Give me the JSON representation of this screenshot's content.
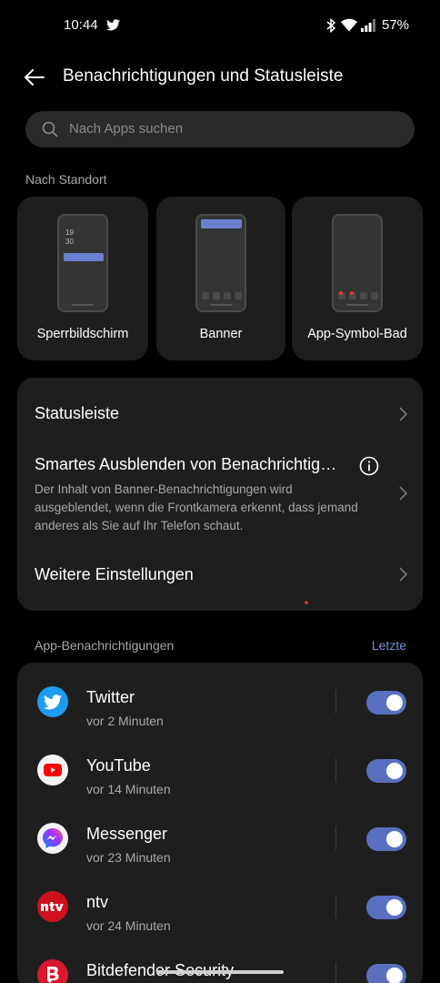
{
  "status_bar": {
    "time": "10:44",
    "battery": "57%",
    "notification_icons": [
      "twitter-icon"
    ],
    "system_icons": [
      "bluetooth-icon",
      "wifi-icon",
      "signal-icon"
    ]
  },
  "header": {
    "title": "Benachrichtigungen und Statusleiste"
  },
  "search": {
    "placeholder": "Nach Apps suchen"
  },
  "notification_styles": {
    "section_label": "Nach Standort",
    "preview_clock": [
      "19",
      "30"
    ],
    "items": [
      {
        "label": "Sperrbildschirm",
        "preview": "lockscreen"
      },
      {
        "label": "Banner",
        "preview": "banner"
      },
      {
        "label": "App-Symbol-Bad",
        "preview": "badge"
      }
    ]
  },
  "settings": {
    "status_bar_label": "Statusleiste",
    "smart_hide": {
      "title": "Smartes Ausblenden von Benachrichtig…",
      "description": "Der Inhalt von Banner-Benachrichtigungen wird ausgeblendet, wenn die Frontkamera erkennt, dass jemand anderes als Sie auf Ihr Telefon schaut."
    },
    "more_settings_label": "Weitere Einstellungen"
  },
  "app_notifications": {
    "section_label": "App-Benachrichtigungen",
    "sort_label": "Letzte",
    "apps": [
      {
        "name": "Twitter",
        "time": "vor 2 Minuten",
        "enabled": true,
        "icon": "twitter-icon",
        "color": "#1d9bf0"
      },
      {
        "name": "YouTube",
        "time": "vor 14 Minuten",
        "enabled": true,
        "icon": "youtube-icon",
        "color": "#ff0000"
      },
      {
        "name": "Messenger",
        "time": "vor 23 Minuten",
        "enabled": true,
        "icon": "messenger-icon",
        "color": "#a033ff"
      },
      {
        "name": "ntv",
        "time": "vor 24 Minuten",
        "enabled": true,
        "icon": "ntv-icon",
        "color": "#d1101e"
      },
      {
        "name": "Bitdefender Security",
        "time": "",
        "enabled": true,
        "icon": "bitdefender-icon",
        "color": "#d9182d"
      }
    ]
  },
  "colors": {
    "accent": "#5a6fbf",
    "link": "#7b8ed8",
    "card_bg": "#1e1e1e",
    "background": "#000000"
  }
}
